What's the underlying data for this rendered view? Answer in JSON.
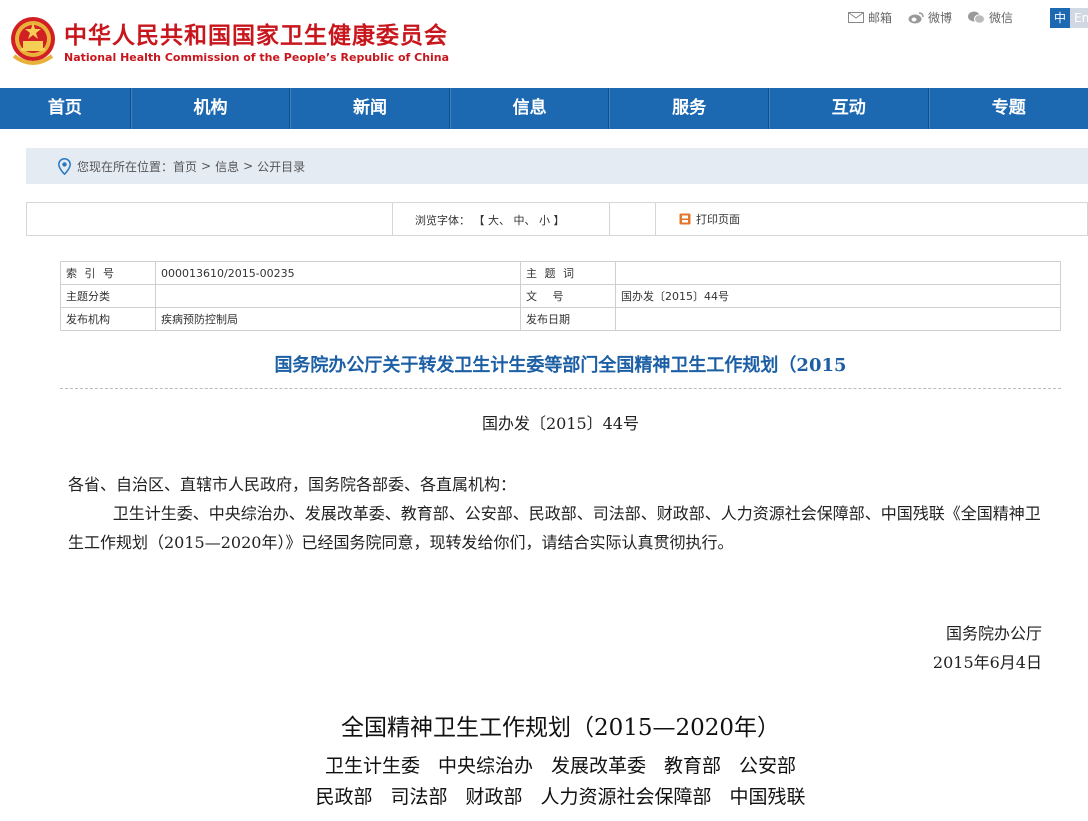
{
  "header": {
    "site_name_cn": "中华人民共和国国家卫生健康委员会",
    "site_name_en": "National Health Commission of the People’s Republic of China",
    "tools": [
      {
        "icon": "mail-icon",
        "label": "邮箱"
      },
      {
        "icon": "weibo-icon",
        "label": "微博"
      },
      {
        "icon": "wechat-icon",
        "label": "微信"
      }
    ],
    "lang_active": "中",
    "lang_other": "En"
  },
  "nav": {
    "items": [
      "首页",
      "机构",
      "新闻",
      "信息",
      "服务",
      "互动",
      "专题"
    ]
  },
  "breadcrumb": {
    "prefix": "您现在所在位置：",
    "items": [
      "首页",
      "信息",
      "公开目录"
    ],
    "separator": ">"
  },
  "toolbar": {
    "font_label": "浏览字体：",
    "bracket_open": "【",
    "bracket_close": "】",
    "size_large": "大",
    "size_medium": "中",
    "size_small": "小",
    "print_label": "打印页面"
  },
  "meta": {
    "index_label": "索 引 号",
    "index_value": "000013610/2015-00235",
    "keyword_label": "主 题 词",
    "keyword_value": "",
    "category_label": "主题分类",
    "category_value": "",
    "docno_label": "文 号",
    "docno_value": "国办发〔2015〕44号",
    "publisher_label": "发布机构",
    "publisher_value": "疾病预防控制局",
    "date_label": "发布日期",
    "date_value": ""
  },
  "article": {
    "title": "国务院办公厅关于转发卫生计生委等部门全国精神卫生工作规划（2015",
    "doc_number": "国办发〔2015〕44号",
    "salutation": "各省、自治区、直辖市人民政府，国务院各部委、各直属机构：",
    "paragraph": "卫生计生委、中央综治办、发展改革委、教育部、公安部、民政部、司法部、财政部、人力资源社会保障部、中国残联《全国精神卫生工作规划（2015—2020年）》已经国务院同意，现转发给你们，请结合实际认真贯彻执行。",
    "signer": "国务院办公厅",
    "sign_date": "2015年6月4日",
    "plan_title": "全国精神卫生工作规划（2015—2020年）",
    "plan_depts_line1": [
      "卫生计生委",
      "中央综治办",
      "发展改革委",
      "教育部",
      "公安部"
    ],
    "plan_depts_line2": [
      "民政部",
      "司法部",
      "财政部",
      "人力资源社会保障部",
      "中国残联"
    ]
  },
  "colors": {
    "brand_red": "#c8161d",
    "nav_blue": "#1c69b2",
    "title_blue": "#1c5fa5",
    "breadcrumb_bg": "#e5ebf3"
  }
}
